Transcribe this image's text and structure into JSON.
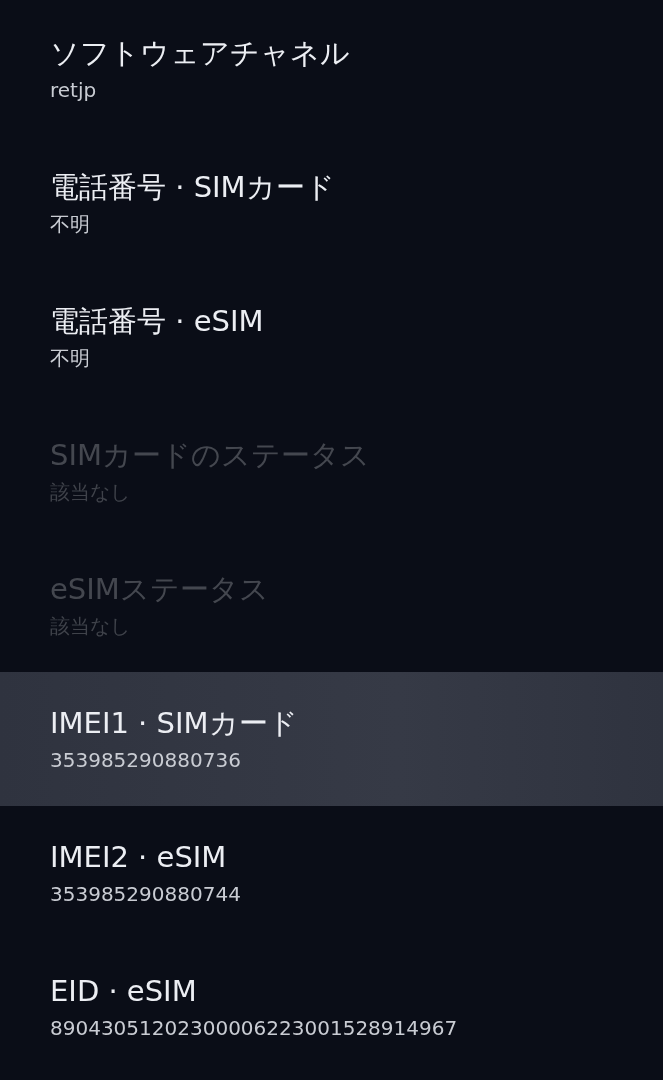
{
  "items": [
    {
      "title": "ソフトウェアチャネル",
      "value": "retjp",
      "disabled": false,
      "selected": false
    },
    {
      "title": "電話番号 · SIMカード",
      "value": "不明",
      "disabled": false,
      "selected": false
    },
    {
      "title": "電話番号 · eSIM",
      "value": "不明",
      "disabled": false,
      "selected": false
    },
    {
      "title": "SIMカードのステータス",
      "value": "該当なし",
      "disabled": true,
      "selected": false
    },
    {
      "title": "eSIMステータス",
      "value": "該当なし",
      "disabled": true,
      "selected": false
    },
    {
      "title": "IMEI1 · SIMカード",
      "value": "353985290880736",
      "disabled": false,
      "selected": true
    },
    {
      "title": "IMEI2 · eSIM",
      "value": "353985290880744",
      "disabled": false,
      "selected": false
    },
    {
      "title": "EID · eSIM",
      "value": "89043051202300006223001528914967",
      "disabled": false,
      "selected": false
    }
  ]
}
